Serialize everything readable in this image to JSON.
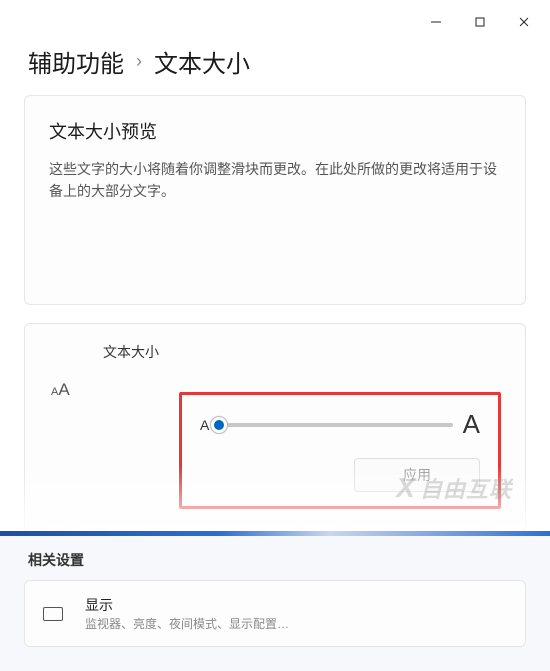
{
  "breadcrumb": {
    "parent": "辅助功能",
    "current": "文本大小"
  },
  "preview": {
    "title": "文本大小预览",
    "description": "这些文字的大小将随着你调整滑块而更改。在此处所做的更改将适用于设备上的大部分文字。"
  },
  "textSize": {
    "label": "文本大小",
    "minGlyph": "A",
    "maxGlyph": "A",
    "applyLabel": "应用",
    "sliderValuePercent": 0
  },
  "related": {
    "sectionTitle": "相关设置",
    "display": {
      "title": "显示",
      "subtitle": "监视器、亮度、夜间模式、显示配置…"
    }
  },
  "watermark": "自由互联"
}
